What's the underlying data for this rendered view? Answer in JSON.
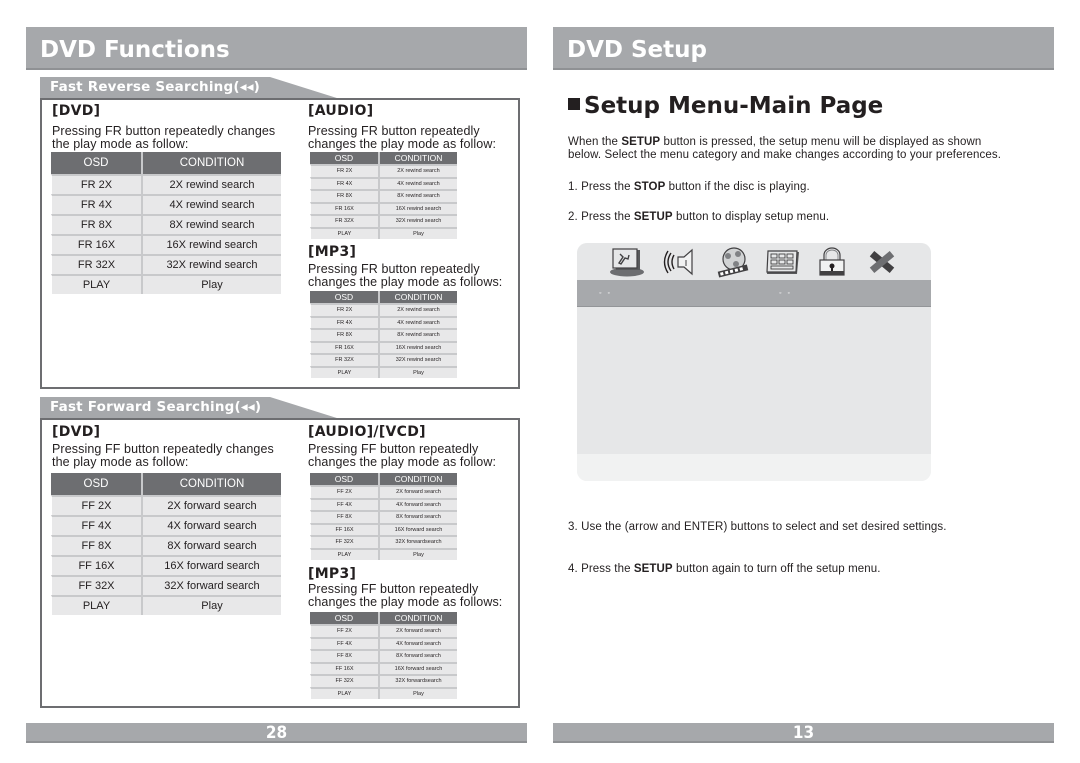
{
  "left_page": {
    "header": "DVD Functions",
    "page_number": "28",
    "fast_reverse": {
      "title": "Fast Reverse Searching(◂◂)",
      "dvd": {
        "heading": "[DVD]",
        "description_line1": "Pressing FR button repeatedly changes",
        "description_line2": "the play mode as follow:",
        "columns": [
          "OSD",
          "CONDITION"
        ],
        "rows": [
          [
            "FR 2X",
            "2X rewind search"
          ],
          [
            "FR 4X",
            "4X rewind search"
          ],
          [
            "FR 8X",
            "8X rewind search"
          ],
          [
            "FR 16X",
            "16X rewind search"
          ],
          [
            "FR 32X",
            "32X rewind search"
          ],
          [
            "PLAY",
            "Play"
          ]
        ]
      },
      "audio": {
        "heading": "[AUDIO]",
        "description_line1": "Pressing FR button repeatedly",
        "description_line2": "changes the play mode as follow:",
        "columns": [
          "OSD",
          "CONDITION"
        ],
        "rows": [
          [
            "FR 2X",
            "2X rewind search"
          ],
          [
            "FR 4X",
            "4X rewind search"
          ],
          [
            "FR 8X",
            "8X rewind search"
          ],
          [
            "FR 16X",
            "16X rewind search"
          ],
          [
            "FR 32X",
            "32X rewind search"
          ],
          [
            "PLAY",
            "Play"
          ]
        ]
      },
      "mp3": {
        "heading": "[MP3]",
        "description_line1": "Pressing FR button repeatedly",
        "description_line2": "changes the play mode as follows:",
        "columns": [
          "OSD",
          "CONDITION"
        ],
        "rows": [
          [
            "FR 2X",
            "2X rewind search"
          ],
          [
            "FR 4X",
            "4X rewind search"
          ],
          [
            "FR 8X",
            "8X rewind search"
          ],
          [
            "FR 16X",
            "16X rewind search"
          ],
          [
            "FR 32X",
            "32X rewind search"
          ],
          [
            "PLAY",
            "Play"
          ]
        ]
      }
    },
    "fast_forward": {
      "title": "Fast Forward Searching(◂◂)",
      "dvd": {
        "heading": "[DVD]",
        "description_line1": "Pressing FF button repeatedly changes",
        "description_line2": "the play mode as follow:",
        "columns": [
          "OSD",
          "CONDITION"
        ],
        "rows": [
          [
            "FF 2X",
            "2X forward search"
          ],
          [
            "FF 4X",
            "4X forward search"
          ],
          [
            "FF 8X",
            "8X forward search"
          ],
          [
            "FF 16X",
            "16X forward search"
          ],
          [
            "FF 32X",
            "32X forward search"
          ],
          [
            "PLAY",
            "Play"
          ]
        ]
      },
      "audio_vcd": {
        "heading": "[AUDIO]/[VCD]",
        "description_line1": "Pressing FF button repeatedly",
        "description_line2": "changes the play mode as follow:",
        "columns": [
          "OSD",
          "CONDITION"
        ],
        "rows": [
          [
            "FF 2X",
            "2X forward search"
          ],
          [
            "FF 4X",
            "4X forward search"
          ],
          [
            "FF 8X",
            "8X forward search"
          ],
          [
            "FF 16X",
            "16X forward search"
          ],
          [
            "FF 32X",
            "32X forwardsearch"
          ],
          [
            "PLAY",
            "Play"
          ]
        ]
      },
      "mp3": {
        "heading": "[MP3]",
        "description_line1": "Pressing FF button repeatedly",
        "description_line2": "changes the play mode as follows:",
        "columns": [
          "OSD",
          "CONDITION"
        ],
        "rows": [
          [
            "FF 2X",
            "2X forward search"
          ],
          [
            "FF 4X",
            "4X forward search"
          ],
          [
            "FF 8X",
            "8X forward search"
          ],
          [
            "FF 16X",
            "16X forward search"
          ],
          [
            "FF 32X",
            "32X forwardsearch"
          ],
          [
            "PLAY",
            "Play"
          ]
        ]
      }
    }
  },
  "right_page": {
    "header": "DVD Setup",
    "page_number": "13",
    "title": "Setup Menu-Main Page",
    "intro": {
      "prefix": "When the ",
      "bold": "SETUP",
      "suffix": " button is pressed, the setup menu will be displayed as shown",
      "line2": "below. Select the menu category and make changes according to your preferences."
    },
    "steps": [
      {
        "prefix": "1. Press the ",
        "bold": "STOP",
        "suffix": " button if the disc is playing."
      },
      {
        "prefix": "2. Press the ",
        "bold": "SETUP",
        "suffix": " button to display setup menu."
      },
      {
        "prefix": "3. Use the (arrow and ENTER) buttons to select and set desired settings.",
        "bold": "",
        "suffix": ""
      },
      {
        "prefix": "4. Press the ",
        "bold": "SETUP",
        "suffix": " button again to turn off the setup menu."
      }
    ],
    "setup_menu": {
      "icons": [
        "general-setup-icon",
        "audio-setup-icon",
        "video-setup-icon",
        "preference-icon",
        "password-lock-icon",
        "exit-icon"
      ],
      "bar_left": "◦ ◦",
      "bar_right": "◦ ◦"
    }
  },
  "colors": {
    "header_gray": "#a6a8ab",
    "table_header": "#6d6e71",
    "table_cell": "#e8e8e9",
    "border": "#6d6e71",
    "menu_bar": "#a7a9ac"
  }
}
